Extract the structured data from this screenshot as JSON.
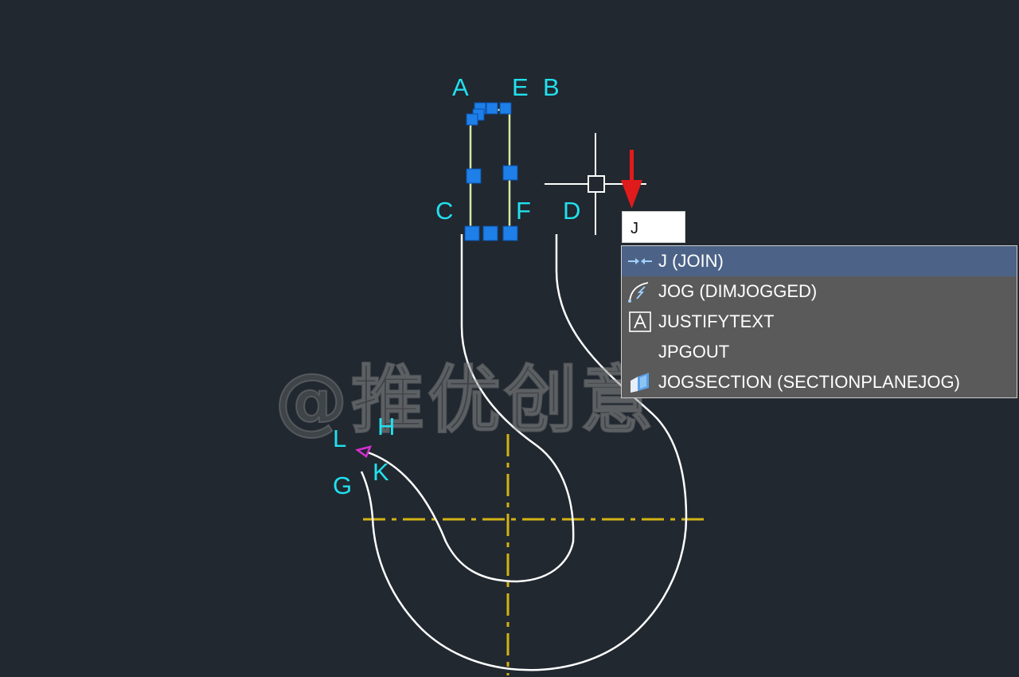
{
  "drawing": {
    "point_labels": [
      "A",
      "E",
      "B",
      "C",
      "F",
      "D",
      "L",
      "H",
      "K",
      "G"
    ],
    "colors": {
      "background": "#212830",
      "geometry": "#ffffff",
      "center_lines": "#d4b214",
      "grips": "#1f7fe8",
      "selected_lines": "#d8e8a8",
      "labels": "#22e0ee",
      "marker": "#d42fd0",
      "arrow": "#e01b1b",
      "crosshair": "#ffffff"
    }
  },
  "watermark": "@推优创意",
  "command_input": {
    "value": "J"
  },
  "autocomplete": {
    "items": [
      {
        "label": "J (JOIN)",
        "icon": "join-icon",
        "selected": true
      },
      {
        "label": "JOG (DIMJOGGED)",
        "icon": "dimjogged-icon",
        "selected": false
      },
      {
        "label": "JUSTIFYTEXT",
        "icon": "justifytext-icon",
        "selected": false
      },
      {
        "label": "JPGOUT",
        "icon": "",
        "selected": false
      },
      {
        "label": "JOGSECTION (SECTIONPLANEJOG)",
        "icon": "jogsection-icon",
        "selected": false
      }
    ]
  }
}
